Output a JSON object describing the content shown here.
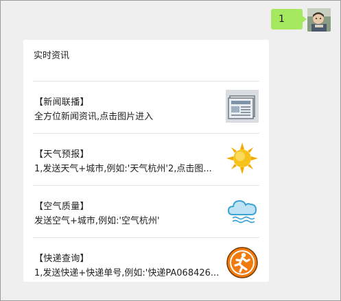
{
  "sent_message": {
    "text": "1"
  },
  "card": {
    "title": "实时资讯",
    "items": [
      {
        "title": "【新闻联播】",
        "desc": "全方位新闻资讯,点击图片进入",
        "icon": "newspaper-icon"
      },
      {
        "title": "【天气预报】",
        "desc": "1,发送天气+城市,例如:'天气杭州'2,点击图...",
        "icon": "sun-icon"
      },
      {
        "title": "【空气质量】",
        "desc": "发送空气+城市,例如:'空气杭州'",
        "icon": "cloud-icon"
      },
      {
        "title": "【快递查询】",
        "desc": "1,发送快递+快递单号,例如:'快递PA068426...",
        "icon": "runner-icon"
      }
    ]
  },
  "colors": {
    "bubble": "#a6e860",
    "background": "#efeff0",
    "runner_orange": "#f07c10"
  }
}
